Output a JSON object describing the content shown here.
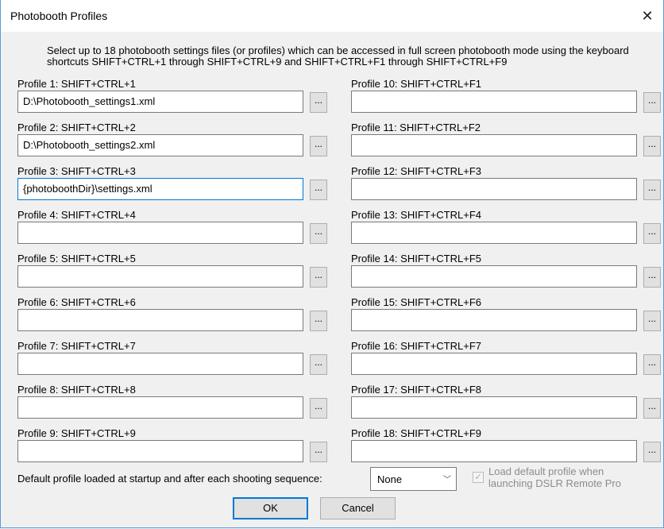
{
  "window": {
    "title": "Photobooth Profiles",
    "close_glyph": "✕"
  },
  "description": "Select up to 18 photobooth settings files (or profiles) which can be accessed in full screen photobooth mode using the keyboard shortcuts SHIFT+CTRL+1 through SHIFT+CTRL+9 and SHIFT+CTRL+F1 through SHIFT+CTRL+F9",
  "profiles": [
    {
      "label": "Profile 1: SHIFT+CTRL+1",
      "value": "D:\\Photobooth_settings1.xml"
    },
    {
      "label": "Profile 2: SHIFT+CTRL+2",
      "value": "D:\\Photobooth_settings2.xml"
    },
    {
      "label": "Profile 3: SHIFT+CTRL+3",
      "value": "{photoboothDir}\\settings.xml"
    },
    {
      "label": "Profile 4: SHIFT+CTRL+4",
      "value": ""
    },
    {
      "label": "Profile 5: SHIFT+CTRL+5",
      "value": ""
    },
    {
      "label": "Profile 6: SHIFT+CTRL+6",
      "value": ""
    },
    {
      "label": "Profile 7: SHIFT+CTRL+7",
      "value": ""
    },
    {
      "label": "Profile 8: SHIFT+CTRL+8",
      "value": ""
    },
    {
      "label": "Profile 9: SHIFT+CTRL+9",
      "value": ""
    },
    {
      "label": "Profile 10: SHIFT+CTRL+F1",
      "value": ""
    },
    {
      "label": "Profile 11: SHIFT+CTRL+F2",
      "value": ""
    },
    {
      "label": "Profile 12: SHIFT+CTRL+F3",
      "value": ""
    },
    {
      "label": "Profile 13: SHIFT+CTRL+F4",
      "value": ""
    },
    {
      "label": "Profile 14: SHIFT+CTRL+F5",
      "value": ""
    },
    {
      "label": "Profile 15: SHIFT+CTRL+F6",
      "value": ""
    },
    {
      "label": "Profile 16: SHIFT+CTRL+F7",
      "value": ""
    },
    {
      "label": "Profile 17: SHIFT+CTRL+F8",
      "value": ""
    },
    {
      "label": "Profile 18: SHIFT+CTRL+F9",
      "value": ""
    }
  ],
  "browse_label": "...",
  "default_profile": {
    "label": "Default profile loaded at startup and after each shooting sequence:",
    "selected": "None",
    "chevron": "﹀"
  },
  "load_default": {
    "label": "Load default profile when launching DSLR Remote Pro",
    "checked": true,
    "enabled": false,
    "check_glyph": "✓"
  },
  "buttons": {
    "ok": "OK",
    "cancel": "Cancel"
  },
  "colors": {
    "accent": "#0078d7",
    "disabled_text": "#8c8c8c"
  }
}
